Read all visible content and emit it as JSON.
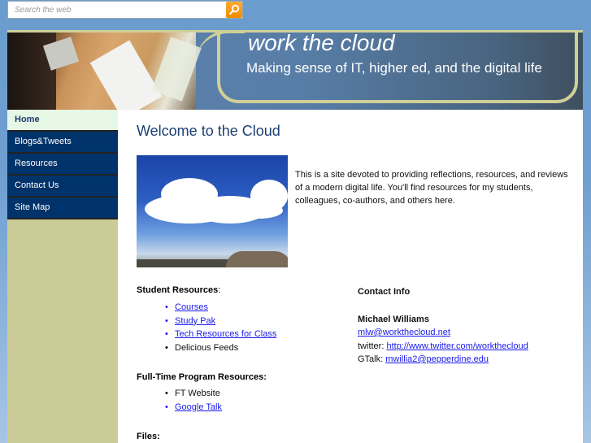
{
  "search": {
    "placeholder": "Search the web",
    "icon": "search-icon"
  },
  "header": {
    "title": "work the cloud",
    "tagline": "Making sense of IT, higher ed, and the digital life"
  },
  "sidebar": {
    "items": [
      {
        "label": "Home",
        "active": true
      },
      {
        "label": "Blogs&Tweets"
      },
      {
        "label": "Resources"
      },
      {
        "label": "Contact Us"
      },
      {
        "label": "Site Map"
      }
    ]
  },
  "main": {
    "title": "Welcome to the Cloud",
    "intro": "This is a site devoted to providing reflections, resources, and reviews of a modern digital life.  You'll find resources for my students, colleagues, co-authors, and others here.",
    "student_resources": {
      "heading": "Student Resources",
      "suffix": ":",
      "items": [
        {
          "label": "Courses",
          "link": true
        },
        {
          "label": "Study Pak",
          "link": true
        },
        {
          "label": "Tech Resources for Class",
          "link": true
        },
        {
          "label": "Delicious Feeds",
          "link": false
        }
      ]
    },
    "ft_resources": {
      "heading": "Full-Time Program Resources:",
      "items": [
        {
          "label": "FT Website",
          "link": false
        },
        {
          "label": "Google Talk",
          "link": true
        }
      ]
    },
    "files": {
      "heading": "Files:"
    },
    "contact": {
      "heading": "Contact Info",
      "name": "Michael Williams",
      "email": "mlw@workthecloud.net",
      "twitter_label": "twitter:",
      "twitter_url": "http://www.twitter.com/workthecloud",
      "gtalk_label": "GTalk:",
      "gtalk": "mwillia2@pepperdine.edu"
    }
  }
}
